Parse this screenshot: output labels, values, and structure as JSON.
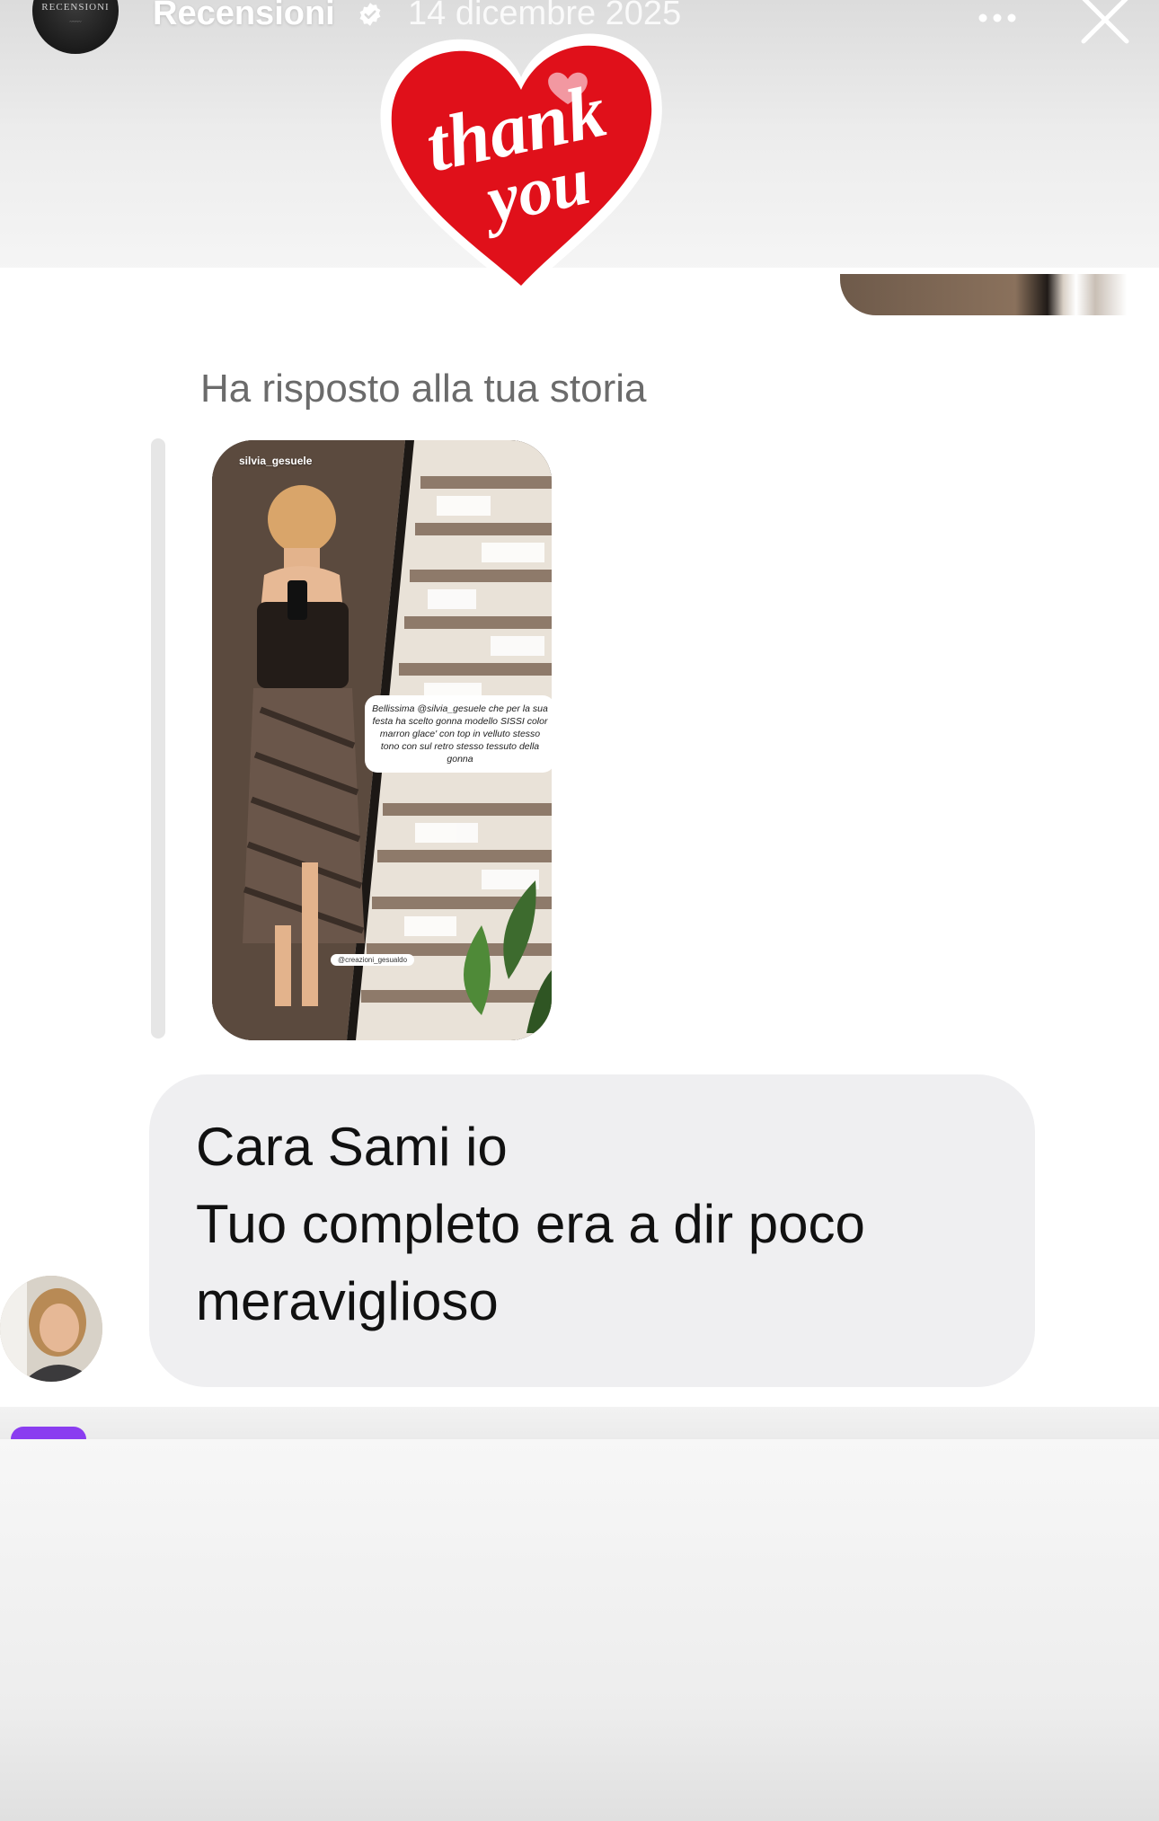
{
  "story_header": {
    "account_name": "Recensioni",
    "date": "14 dicembre 2025",
    "avatar_text": "RECENSIONI"
  },
  "sticker": {
    "line1": "thank",
    "line2": "you",
    "color": "#e0101a"
  },
  "chat": {
    "reply_label": "Ha risposto alla tua storia",
    "story_thumbnail": {
      "username": "silvia_gesuele",
      "caption": "Bellissima @silvia_gesuele che per la sua festa ha scelto gonna modello SISSI color marron glace' con top in velluto stesso tono con sul retro stesso tessuto della gonna",
      "tag": "@creazioni_gesualdo"
    },
    "message_lines": [
      "Cara Sami io",
      "Tuo completo era a dir poco",
      "meraviglioso"
    ]
  },
  "colors": {
    "bubble": "#efeff1",
    "reply_label": "#6b6b6b",
    "accent_purple": "#8a3df0"
  }
}
